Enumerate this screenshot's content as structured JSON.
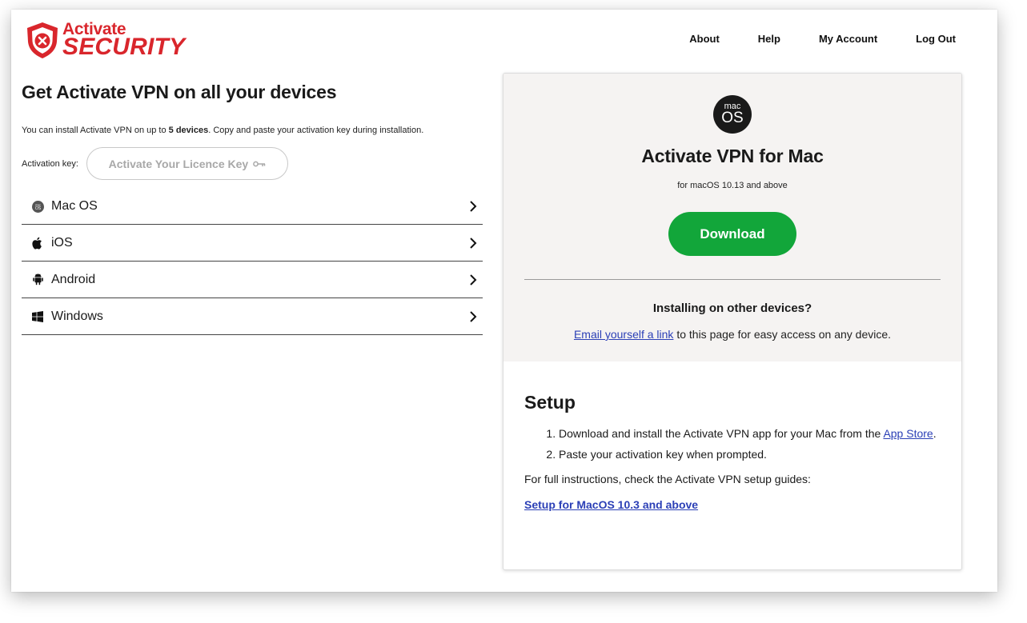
{
  "brand": {
    "name_top": "Activate",
    "name_bottom": "SECURITY",
    "color": "#d9262c"
  },
  "nav": {
    "items": [
      {
        "label": "About"
      },
      {
        "label": "Help"
      },
      {
        "label": "My Account"
      },
      {
        "label": "Log Out"
      }
    ]
  },
  "main": {
    "title": "Get Activate VPN on all your devices",
    "intro_before": "You can install Activate VPN on up to ",
    "intro_bold": "5 devices",
    "intro_after": ". Copy and paste your activation key during installation.",
    "key_label": "Activation key:",
    "key_button": "Activate Your Licence Key",
    "key_icon": "key-icon",
    "devices": [
      {
        "label": "Mac OS",
        "icon": "macos-icon"
      },
      {
        "label": "iOS",
        "icon": "apple-icon"
      },
      {
        "label": "Android",
        "icon": "android-icon"
      },
      {
        "label": "Windows",
        "icon": "windows-icon"
      }
    ]
  },
  "card": {
    "badge_top": "mac",
    "badge_bottom": "OS",
    "title": "Activate VPN for Mac",
    "subtitle": "for macOS 10.13 and above",
    "download_label": "Download",
    "download_color": "#12a63a",
    "other_title": "Installing on other devices?",
    "other_link": "Email yourself a link",
    "other_text": " to this page for easy access on any device.",
    "setup_title": "Setup",
    "steps": [
      {
        "before": "Download and install the Activate VPN app for your Mac from the ",
        "link": "App Store",
        "after": "."
      },
      {
        "before": "Paste your activation key when prompted.",
        "link": "",
        "after": ""
      }
    ],
    "full_instructions": "For full instructions, check the Activate VPN setup guides:",
    "guide_link": "Setup for MacOS 10.3 and above",
    "link_color": "#2b3fb6"
  }
}
